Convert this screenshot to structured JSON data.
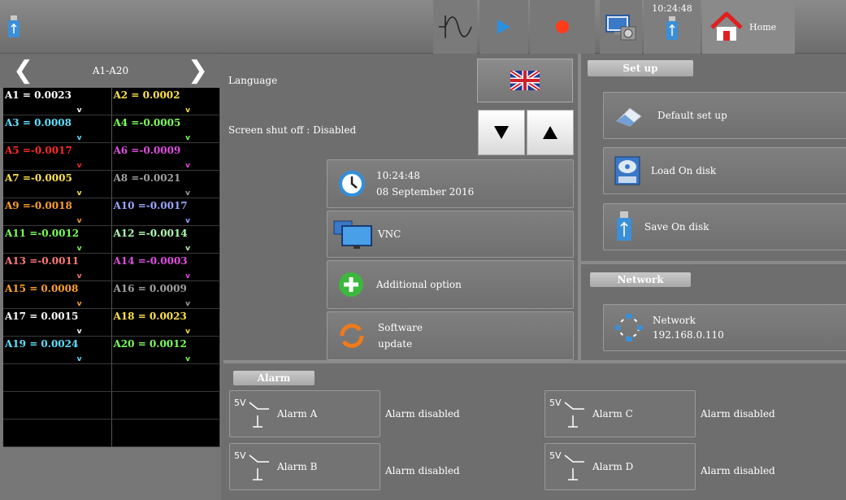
{
  "topbar": {
    "usb_icon": "usb-stick-icon",
    "time": "10:24:48",
    "home_label": "Home"
  },
  "channels": {
    "title": "A1-A20",
    "items": [
      {
        "text": "A1 = 0.0023",
        "color": "#ffffff"
      },
      {
        "text": "A2 = 0.0002",
        "color": "#ffe24a"
      },
      {
        "text": "A3 = 0.0008",
        "color": "#5fe0ff"
      },
      {
        "text": "A4 =-0.0005",
        "color": "#7dff5a"
      },
      {
        "text": "A5 =-0.0017",
        "color": "#ff2a2a"
      },
      {
        "text": "A6 =-0.0009",
        "color": "#e14ee1"
      },
      {
        "text": "A7 =-0.0005",
        "color": "#ffe24a"
      },
      {
        "text": "A8 =-0.0021",
        "color": "#a0a0a0"
      },
      {
        "text": "A9 =-0.0018",
        "color": "#ff9f2a"
      },
      {
        "text": "A10 =-0.0017",
        "color": "#9aa6ff"
      },
      {
        "text": "A11 =-0.0012",
        "color": "#7dff5a"
      },
      {
        "text": "A12 =-0.0014",
        "color": "#b0ffb0"
      },
      {
        "text": "A13 =-0.0011",
        "color": "#ff7a7a"
      },
      {
        "text": "A14 =-0.0003",
        "color": "#e14ee1"
      },
      {
        "text": "A15 = 0.0008",
        "color": "#ff9f2a"
      },
      {
        "text": "A16 = 0.0009",
        "color": "#a0a0a0"
      },
      {
        "text": "A17 = 0.0015",
        "color": "#ffffff"
      },
      {
        "text": "A18 = 0.0023",
        "color": "#ffe24a"
      },
      {
        "text": "A19 = 0.0024",
        "color": "#5fe0ff"
      },
      {
        "text": "A20 = 0.0012",
        "color": "#7dff5a"
      }
    ],
    "down_marker": "v"
  },
  "settings": {
    "language_label": "Language",
    "screen_shutoff_label": "Screen shut off : Disabled",
    "datetime_time": "10:24:48",
    "datetime_date": "08 September 2016",
    "vnc_label": "VNC",
    "additional_option_label": "Additional option",
    "software_update_line1": "Software",
    "software_update_line2": "update"
  },
  "setup": {
    "tab_label": "Set up",
    "default_setup_label": "Default set up",
    "load_label": "Load On disk",
    "save_label": "Save On disk"
  },
  "network": {
    "tab_label": "Network",
    "button_title": "Network",
    "ip": "192.168.0.110"
  },
  "alarm": {
    "tab_label": "Alarm",
    "supply_label": "5V",
    "items": [
      {
        "name": "Alarm  A",
        "status": "Alarm disabled"
      },
      {
        "name": "Alarm  B",
        "status": "Alarm disabled"
      },
      {
        "name": "Alarm  C",
        "status": "Alarm disabled"
      },
      {
        "name": "Alarm  D",
        "status": "Alarm disabled"
      }
    ]
  },
  "colors": {
    "record": "#ff3b1a",
    "play": "#2c8fe0",
    "clock": "#2c8fe0"
  }
}
